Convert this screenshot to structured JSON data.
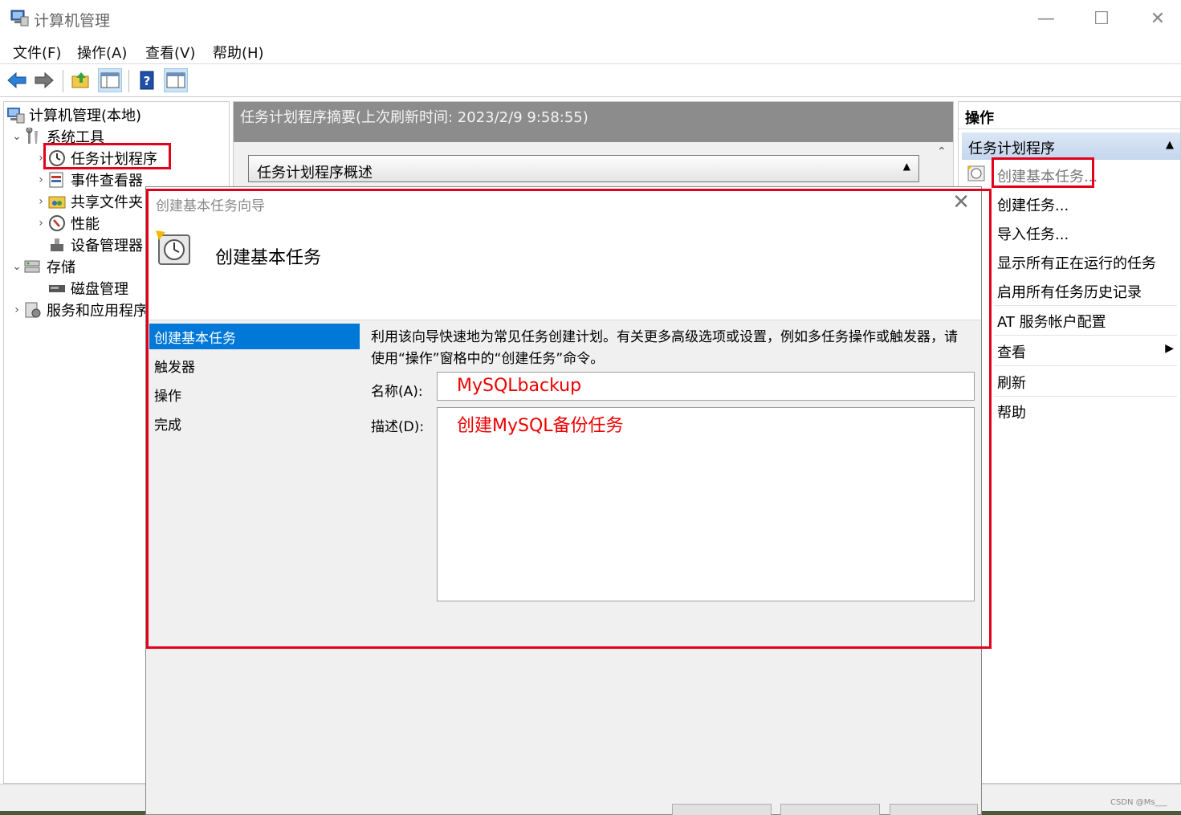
{
  "window": {
    "title": "计算机管理",
    "minimize": "—",
    "maximize": "☐",
    "close": "✕"
  },
  "menu": [
    "文件(F)",
    "操作(A)",
    "查看(V)",
    "帮助(H)"
  ],
  "tree": {
    "root": "计算机管理(本地)",
    "system_tools": "系统工具",
    "task_scheduler": "任务计划程序",
    "event_viewer": "事件查看器",
    "shared_folders": "共享文件夹",
    "performance": "性能",
    "device_manager": "设备管理器",
    "storage": "存储",
    "disk_management": "磁盘管理",
    "services_apps": "服务和应用程序"
  },
  "middle": {
    "header": "任务计划程序摘要(上次刷新时间: 2023/2/9 9:58:55)",
    "section": "任务计划程序概述"
  },
  "actions": {
    "header": "操作",
    "sub_header": "任务计划程序",
    "items": [
      "创建基本任务...",
      "创建任务...",
      "导入任务...",
      "显示所有正在运行的任务",
      "启用所有任务历史记录",
      "AT 服务帐户配置",
      "查看",
      "刷新",
      "帮助"
    ]
  },
  "dialog": {
    "title": "创建基本任务向导",
    "heading": "创建基本任务",
    "steps": [
      "创建基本任务",
      "触发器",
      "操作",
      "完成"
    ],
    "description": "利用该向导快速地为常见任务创建计划。有关更多高级选项或设置，例如多任务操作或触发器，请使用“操作”窗格中的“创建任务”命令。",
    "name_label": "名称(A):",
    "name_value": "MySQLbackup",
    "desc_label": "描述(D):",
    "desc_value": "创建MySQL备份任务"
  },
  "watermark": "CSDN @Ms___",
  "colors": {
    "highlight": "#e3001b",
    "selected_step": "#0078d7",
    "typed_text": "#e00000"
  }
}
